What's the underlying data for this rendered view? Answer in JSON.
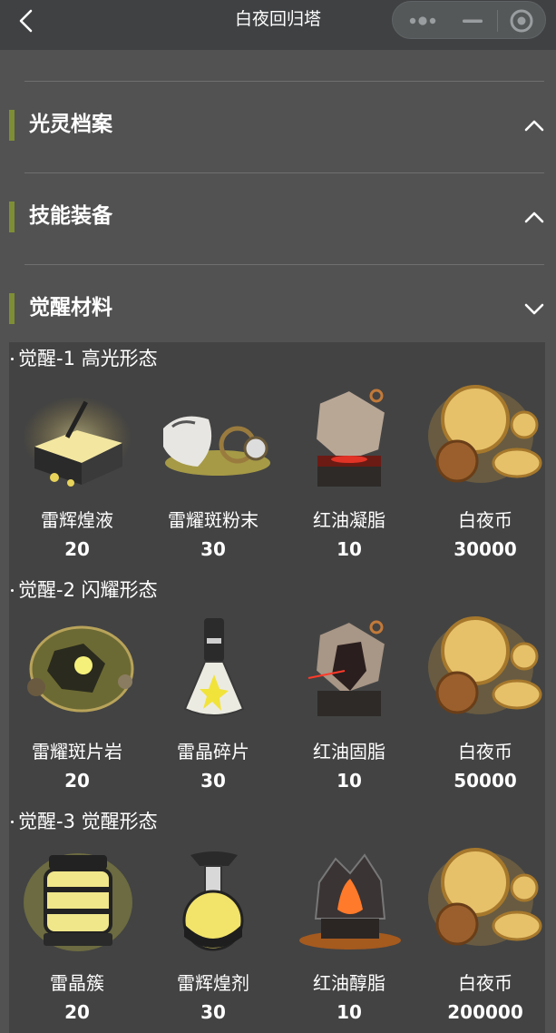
{
  "nav": {
    "title": "白夜回归塔"
  },
  "sections": [
    {
      "title": "光灵档案",
      "state": "collapsed"
    },
    {
      "title": "技能装备",
      "state": "collapsed"
    },
    {
      "title": "觉醒材料",
      "state": "expanded"
    }
  ],
  "awaken": {
    "stages": [
      {
        "title": "觉醒-1 高光形态",
        "items": [
          {
            "name": "雷辉煌液",
            "qty": "20",
            "icon": "gold-liquid-block-icon"
          },
          {
            "name": "雷耀斑粉末",
            "qty": "30",
            "icon": "powder-sack-icon"
          },
          {
            "name": "红油凝脂",
            "qty": "10",
            "icon": "red-oil-cube-icon"
          },
          {
            "name": "白夜币",
            "qty": "30000",
            "icon": "white-night-coins-icon"
          }
        ]
      },
      {
        "title": "觉醒-2 闪耀形态",
        "items": [
          {
            "name": "雷耀斑片岩",
            "qty": "20",
            "icon": "flare-rock-icon"
          },
          {
            "name": "雷晶碎片",
            "qty": "30",
            "icon": "crystal-flask-icon"
          },
          {
            "name": "红油固脂",
            "qty": "10",
            "icon": "red-oil-solid-icon"
          },
          {
            "name": "白夜币",
            "qty": "50000",
            "icon": "white-night-coins-icon"
          }
        ]
      },
      {
        "title": "觉醒-3 觉醒形态",
        "items": [
          {
            "name": "雷晶簇",
            "qty": "20",
            "icon": "crystal-lantern-icon"
          },
          {
            "name": "雷辉煌剂",
            "qty": "30",
            "icon": "gold-potion-icon"
          },
          {
            "name": "红油醇脂",
            "qty": "10",
            "icon": "red-oil-flame-icon"
          },
          {
            "name": "白夜币",
            "qty": "200000",
            "icon": "white-night-coins-icon"
          }
        ]
      }
    ]
  },
  "colors": {
    "accent_bar": "#7e8e35",
    "background": "#525252",
    "panel": "#434343",
    "topbar": "#3f4143"
  }
}
